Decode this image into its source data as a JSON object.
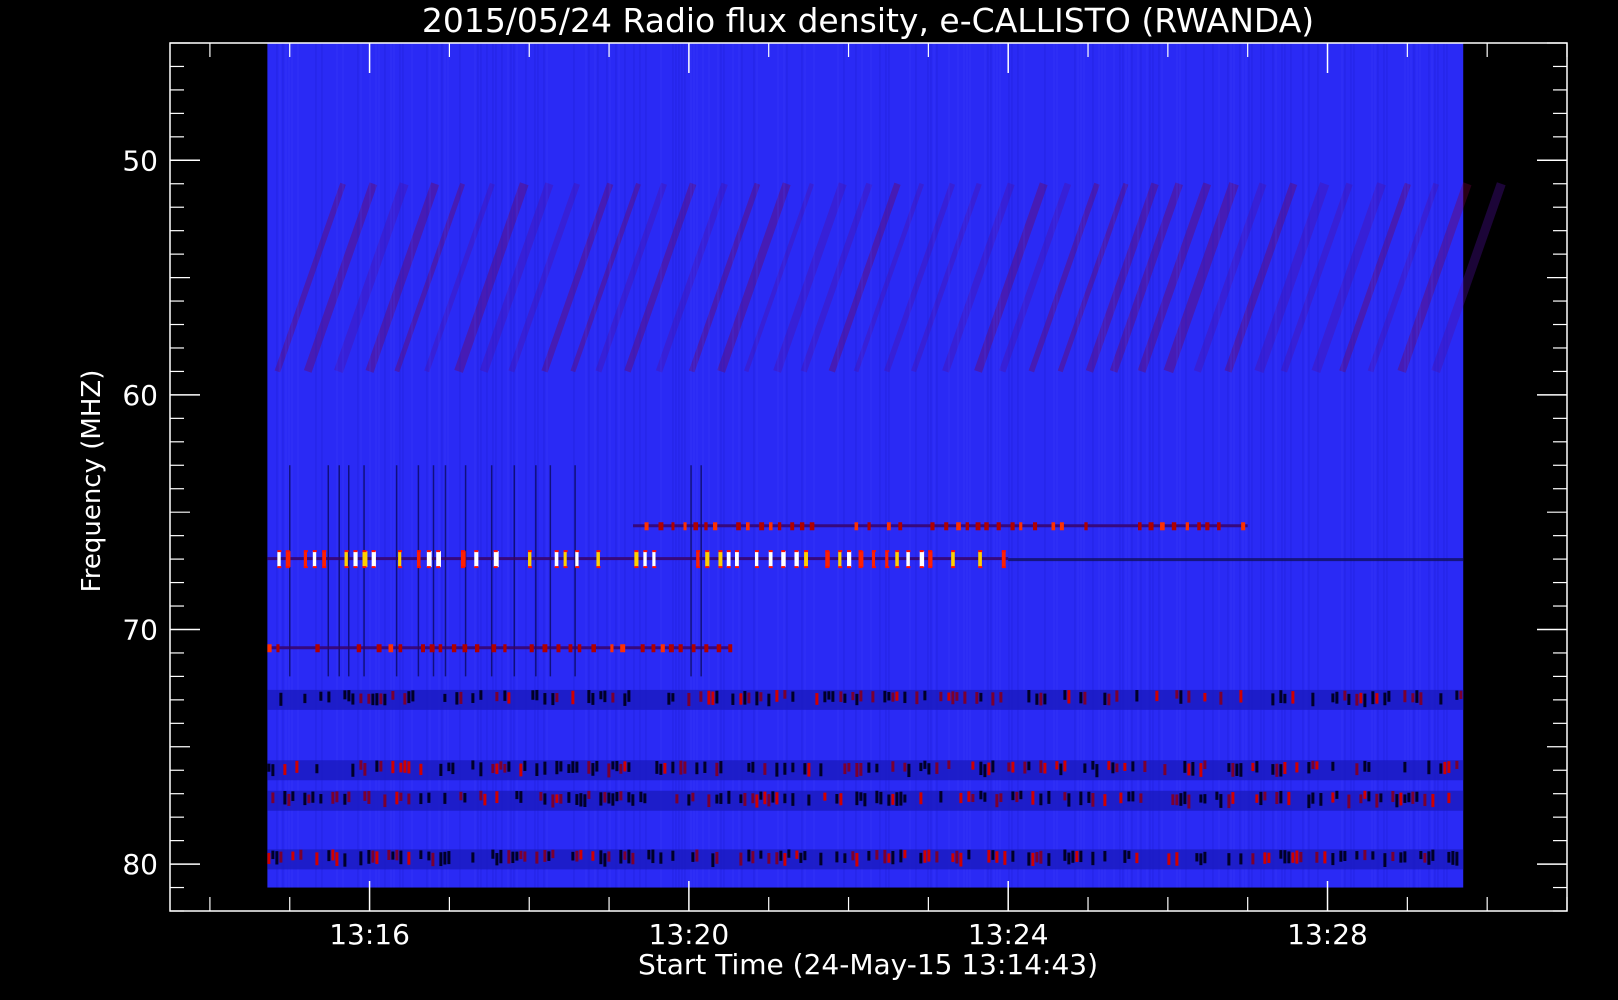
{
  "chart_data": {
    "type": "heatmap",
    "title": "2015/05/24  Radio flux density, e-CALLISTO (RWANDA)",
    "xlabel": "Start Time (24-May-15 13:14:43)",
    "ylabel": "Frequency (MHZ)",
    "x_range_minutes": [
      13.5,
      31.0
    ],
    "data_time_range_minutes": [
      14.72,
      29.7
    ],
    "y_range_mhz": [
      45,
      82
    ],
    "data_freq_range_mhz": [
      45.0,
      81.0
    ],
    "y_inverted": true,
    "x_ticks": [
      {
        "minute": 16,
        "label": "13:16"
      },
      {
        "minute": 20,
        "label": "13:20"
      },
      {
        "minute": 24,
        "label": "13:24"
      },
      {
        "minute": 28,
        "label": "13:28"
      }
    ],
    "y_ticks": [
      {
        "mhz": 50,
        "label": "50"
      },
      {
        "mhz": 60,
        "label": "60"
      },
      {
        "mhz": 70,
        "label": "70"
      },
      {
        "mhz": 80,
        "label": "80"
      }
    ],
    "colormap": [
      "#000000",
      "#1010e0",
      "#3030ff",
      "#b00000",
      "#ff2000",
      "#ffc000",
      "#ffffff"
    ],
    "background_color": "#2a2af5",
    "frame_color": "#ffffff",
    "features": [
      {
        "kind": "interference_band",
        "freq_mhz": 67.0,
        "t_start": 14.72,
        "t_end": 24.0,
        "intensity": "high"
      },
      {
        "kind": "interference_band",
        "freq_mhz": 65.6,
        "t_start": 19.3,
        "t_end": 27.0,
        "intensity": "medium"
      },
      {
        "kind": "interference_band",
        "freq_mhz": 70.8,
        "t_start": 14.72,
        "t_end": 20.5,
        "intensity": "medium"
      },
      {
        "kind": "noise_band",
        "freq_mhz": 73.0,
        "intensity": "low"
      },
      {
        "kind": "noise_band",
        "freq_mhz": 76.0,
        "intensity": "low"
      },
      {
        "kind": "noise_band",
        "freq_mhz": 77.3,
        "intensity": "low"
      },
      {
        "kind": "noise_band",
        "freq_mhz": 79.8,
        "intensity": "low"
      },
      {
        "kind": "diagonal_drift_pattern",
        "freq_range_mhz": [
          51,
          59
        ],
        "intensity": "low"
      }
    ]
  }
}
